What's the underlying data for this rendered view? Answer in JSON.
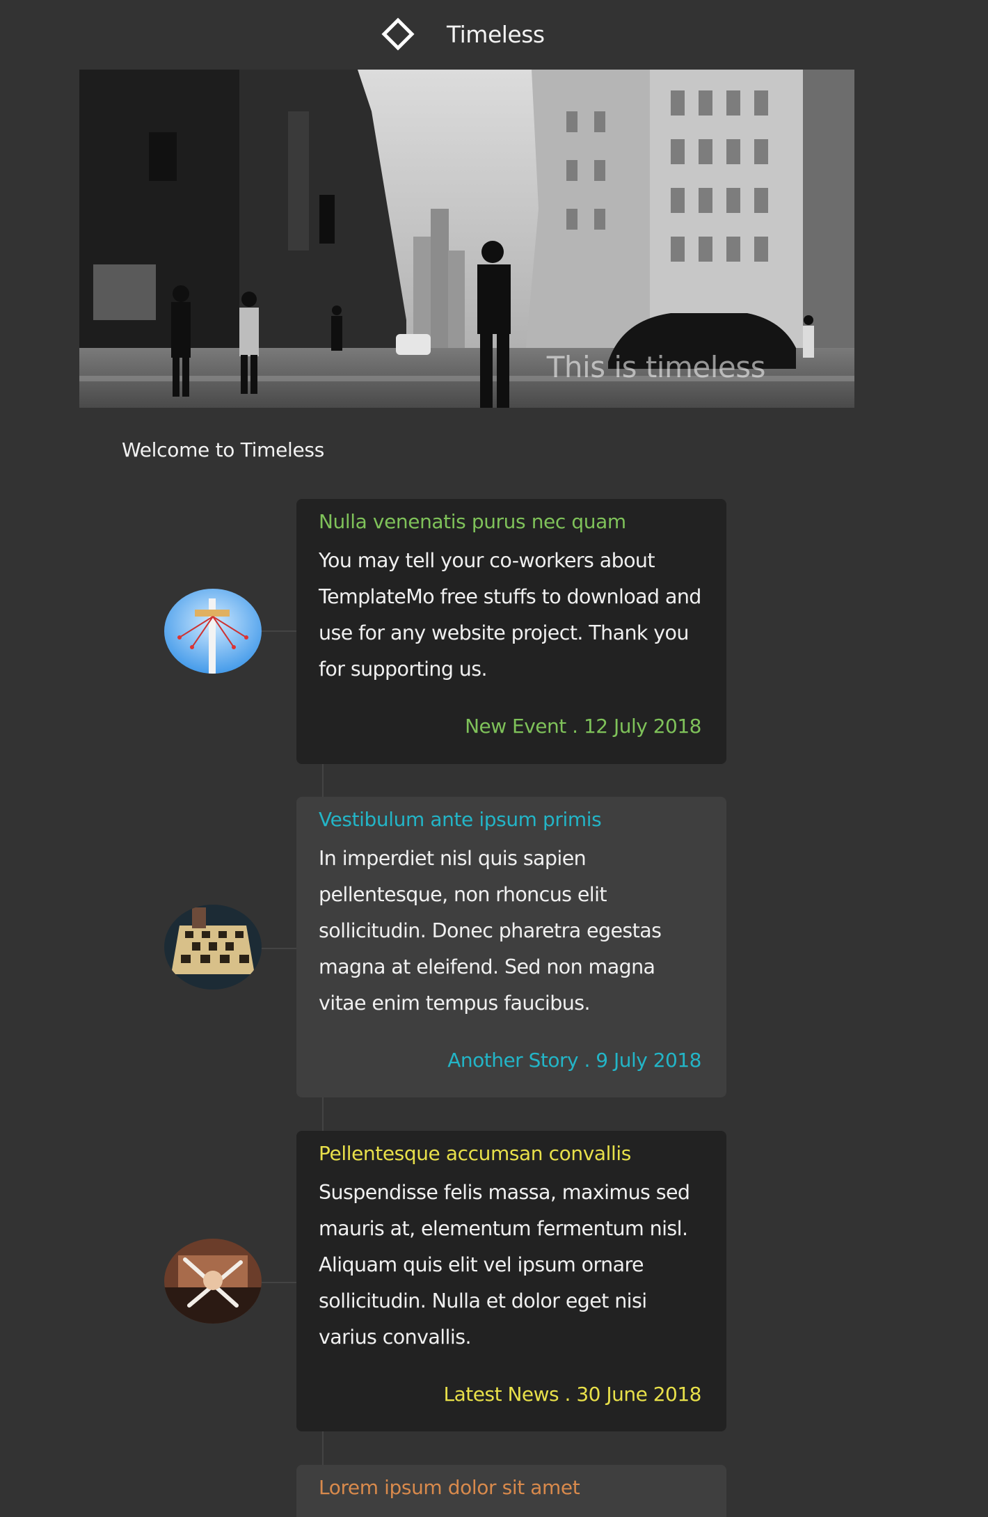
{
  "header": {
    "logo_icon": "diamond-outline-icon",
    "brand": "Timeless"
  },
  "hero": {
    "caption": "This is timeless"
  },
  "welcome": "Welcome to Timeless",
  "timeline": [
    {
      "title": "Nulla venenatis purus nec quam",
      "title_color": "#7fc25a",
      "body": "You may tell your co-workers about TemplateMo free stuffs to download and use for any website project. Thank you for supporting us.",
      "meta": "New Event . 12 July 2018",
      "meta_color": "#7fc25a",
      "image": "amusement-ride-photo"
    },
    {
      "title": "Vestibulum ante ipsum primis",
      "title_color": "#23b5c7",
      "body": "In imperdiet nisl quis sapien pellentesque, non rhoncus elit sollicitudin. Donec pharetra egestas magna at eleifend. Sed non magna vitae enim tempus faucibus.",
      "meta": "Another Story . 9 July 2018",
      "meta_color": "#23b5c7",
      "image": "chess-board-photo"
    },
    {
      "title": "Pellentesque accumsan convallis",
      "title_color": "#e8e04a",
      "body": "Suspendisse felis massa, maximus sed mauris at, elementum fermentum nisl. Aliquam quis elit vel ipsum ornare sollicitudin. Nulla et dolor eget nisi varius convallis.",
      "meta": "Latest News . 30 June 2018",
      "meta_color": "#e8e04a",
      "image": "cooking-photo"
    },
    {
      "title": "Lorem ipsum dolor sit amet",
      "title_color": "#d98a4c",
      "image": ""
    }
  ]
}
